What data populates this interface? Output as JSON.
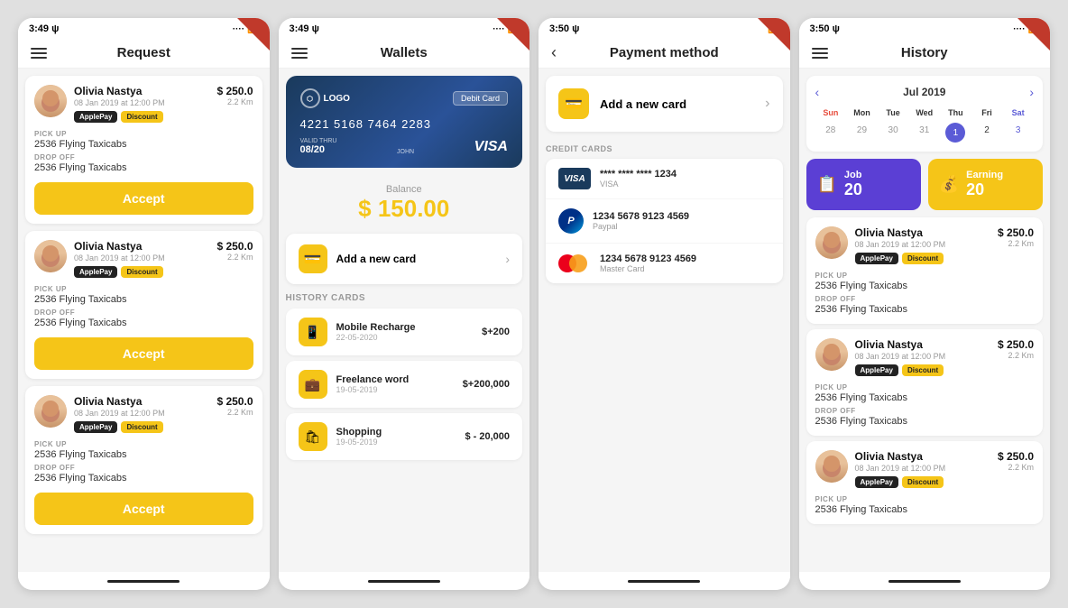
{
  "screens": [
    {
      "id": "request",
      "statusTime": "3:49",
      "title": "Request",
      "cards": [
        {
          "userName": "Olivia Nastya",
          "date": "08 Jan 2019 at 12:00 PM",
          "price": "$ 250.0",
          "distance": "2.2 Km",
          "badges": [
            "ApplePay",
            "Discount"
          ],
          "pickup": "2536 Flying Taxicabs",
          "dropoff": "2536 Flying Taxicabs",
          "btnLabel": "Accept"
        },
        {
          "userName": "Olivia Nastya",
          "date": "08 Jan 2019 at 12:00 PM",
          "price": "$ 250.0",
          "distance": "2.2 Km",
          "badges": [
            "ApplePay",
            "Discount"
          ],
          "pickup": "2536 Flying Taxicabs",
          "dropoff": "2536 Flying Taxicabs",
          "btnLabel": "Accept"
        },
        {
          "userName": "Olivia Nastya",
          "date": "08 Jan 2019 at 12:00 PM",
          "price": "$ 250.0",
          "distance": "2.2 Km",
          "badges": [
            "ApplePay",
            "Discount"
          ],
          "pickup": "2536 Flying Taxicabs",
          "dropoff": "2536 Flying Taxicabs",
          "btnLabel": "Accept"
        }
      ]
    },
    {
      "id": "wallets",
      "statusTime": "3:49",
      "title": "Wallets",
      "card": {
        "logoText": "LOGO",
        "typeLabel": "Debit Card",
        "number": "4221 5168 7464 2283",
        "validThru": "08/20",
        "validLabel": "VALID THRU",
        "holderLabel": "JOHN",
        "network": "VISA"
      },
      "balance": {
        "label": "Balance",
        "amount": "$ 150.00"
      },
      "addCard": {
        "label": "Add a new card"
      },
      "historyTitle": "HISTORY CARDS",
      "historyItems": [
        {
          "name": "Mobile Recharge",
          "date": "22-05-2020",
          "amount": "$+200",
          "icon": "📱"
        },
        {
          "name": "Freelance word",
          "date": "19-05-2019",
          "amount": "$+200,000",
          "icon": "💼"
        },
        {
          "name": "Shopping",
          "date": "19-05-2019",
          "amount": "$ - 20,000",
          "icon": "🛍"
        }
      ]
    },
    {
      "id": "payment",
      "statusTime": "3:50",
      "title": "Payment method",
      "addCard": {
        "label": "Add a new card"
      },
      "creditCardsLabel": "CREDIT CARDS",
      "cards": [
        {
          "type": "visa",
          "number": "**** **** **** 1234",
          "label": "VISA"
        },
        {
          "type": "paypal",
          "number": "1234 5678 9123 4569",
          "label": "Paypal"
        },
        {
          "type": "mastercard",
          "number": "1234 5678 9123 4569",
          "label": "Master Card"
        }
      ]
    },
    {
      "id": "history",
      "statusTime": "3:50",
      "title": "History",
      "calendar": {
        "month": "Jul 2019",
        "dayNames": [
          "Sun",
          "Mon",
          "Tue",
          "Wed",
          "Thu",
          "Fri",
          "Sat"
        ],
        "prevDates": [
          "28",
          "29",
          "30",
          "31"
        ],
        "dates": [
          "1",
          "2",
          "3"
        ],
        "activeDate": "1"
      },
      "stats": [
        {
          "label": "Job",
          "value": "20",
          "type": "job"
        },
        {
          "label": "Earning",
          "value": "20",
          "type": "earn"
        }
      ],
      "trips": [
        {
          "userName": "Olivia Nastya",
          "date": "08 Jan 2019 at 12:00 PM",
          "price": "$250.0",
          "distance": "2.2 Km",
          "badges": [
            "ApplePay",
            "Discount"
          ],
          "pickup": "2536 Flying Taxicabs",
          "dropoff": "2536 Flying Taxicabs"
        },
        {
          "userName": "Olivia Nastya",
          "date": "08 Jan 2019 at 12:00 PM",
          "price": "$250.0",
          "distance": "2.2 Km",
          "badges": [
            "ApplePay",
            "Discount"
          ],
          "pickup": "2536 Flying Taxicabs",
          "dropoff": "2536 Flying Taxicabs"
        },
        {
          "userName": "Olivia Nastya",
          "date": "08 Jan 2019 at 12:00 PM",
          "price": "$250.0",
          "distance": "2.2 Km",
          "badges": [
            "ApplePay",
            "Discount"
          ],
          "pickup": "2536 Flying Taxicabs",
          "dropoff": ""
        }
      ]
    }
  ]
}
